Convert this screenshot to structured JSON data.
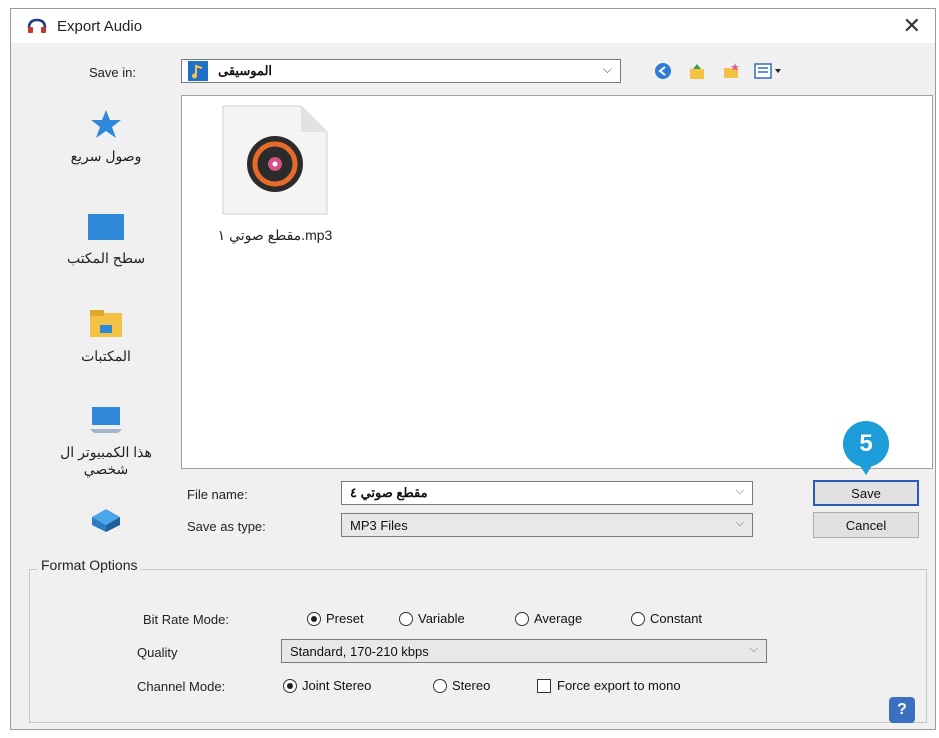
{
  "window": {
    "title": "Export Audio",
    "close_label": "✕"
  },
  "save_in": {
    "label": "Save in:",
    "value": "الموسيقى"
  },
  "places": [
    {
      "label": "وصول سريع"
    },
    {
      "label": "سطح المكتب"
    },
    {
      "label": "المكتبات"
    },
    {
      "label": "هذا الكمبيوتر ال شخصي"
    },
    {
      "label": ""
    }
  ],
  "files": [
    {
      "name": "مقطع صوتي ١.mp3"
    }
  ],
  "file_name": {
    "label": "File name:",
    "value": "مقطع صوتي ٤"
  },
  "save_as_type": {
    "label": "Save as type:",
    "value": "MP3 Files"
  },
  "buttons": {
    "save": "Save",
    "cancel": "Cancel"
  },
  "step_badge": "5",
  "format_options": {
    "title": "Format Options",
    "bit_rate_mode": {
      "label": "Bit Rate Mode:",
      "options": [
        "Preset",
        "Variable",
        "Average",
        "Constant"
      ],
      "selected": "Preset"
    },
    "quality": {
      "label": "Quality",
      "value": "Standard, 170-210 kbps"
    },
    "channel_mode": {
      "label": "Channel Mode:",
      "options": [
        "Joint Stereo",
        "Stereo"
      ],
      "selected": "Joint Stereo",
      "force_mono_label": "Force export to mono",
      "force_mono_checked": false
    },
    "help_label": "?"
  },
  "colors": {
    "accent": "#1c9cd8",
    "default_button_border": "#2a5bb8"
  }
}
